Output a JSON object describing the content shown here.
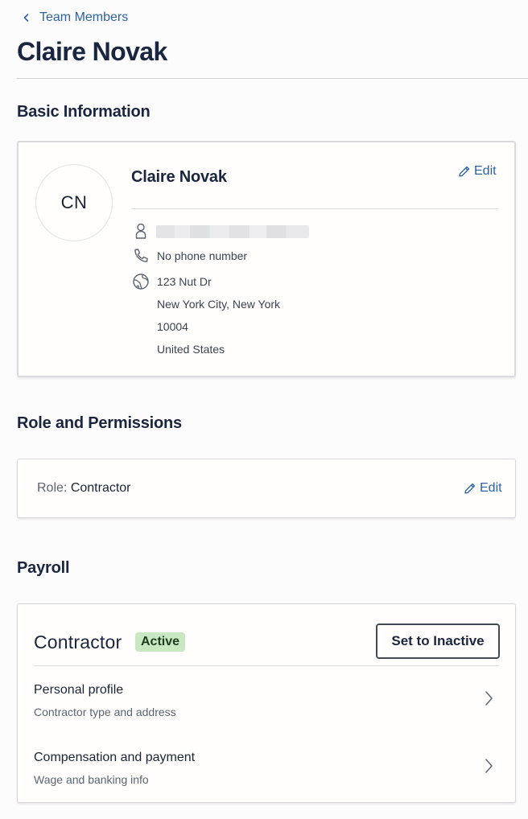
{
  "breadcrumb": {
    "label": "Team Members",
    "icon": "chevron-left-icon"
  },
  "page": {
    "title": "Claire Novak"
  },
  "basic_info": {
    "section_title": "Basic Information",
    "avatar_initials": "CN",
    "name": "Claire Novak",
    "edit_label": "Edit",
    "email_redacted": true,
    "phone": "No phone number",
    "address": {
      "line1": "123 Nut Dr",
      "line2": "New York City, New York",
      "line3": "10004",
      "line4": "United States"
    }
  },
  "role": {
    "section_title": "Role and Permissions",
    "label": "Role:",
    "value": "Contractor",
    "edit_label": "Edit"
  },
  "payroll": {
    "section_title": "Payroll",
    "type_title": "Contractor",
    "status_badge": "Active",
    "set_inactive_label": "Set to Inactive",
    "rows": [
      {
        "title": "Personal profile",
        "subtitle": "Contractor type and address"
      },
      {
        "title": "Compensation and payment",
        "subtitle": "Wage and banking info"
      }
    ]
  },
  "colors": {
    "link": "#2c62a4",
    "heading": "#1a2540",
    "badge_bg": "#c9e8c2"
  }
}
